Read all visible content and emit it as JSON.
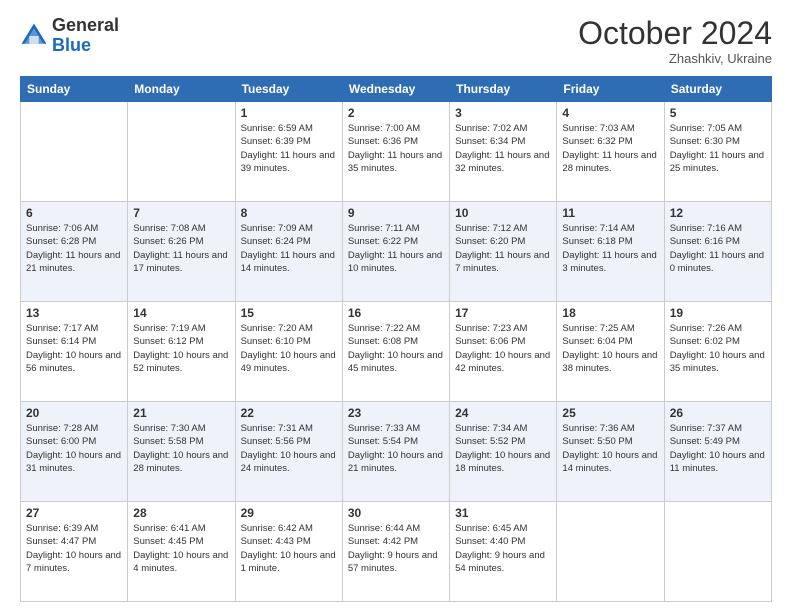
{
  "header": {
    "logo": {
      "general": "General",
      "blue": "Blue"
    },
    "title": "October 2024",
    "subtitle": "Zhashkiv, Ukraine"
  },
  "weekdays": [
    "Sunday",
    "Monday",
    "Tuesday",
    "Wednesday",
    "Thursday",
    "Friday",
    "Saturday"
  ],
  "weeks": [
    [
      {
        "day": "",
        "sunrise": "",
        "sunset": "",
        "daylight": "",
        "empty": true
      },
      {
        "day": "",
        "sunrise": "",
        "sunset": "",
        "daylight": "",
        "empty": true
      },
      {
        "day": "1",
        "sunrise": "Sunrise: 6:59 AM",
        "sunset": "Sunset: 6:39 PM",
        "daylight": "Daylight: 11 hours and 39 minutes.",
        "empty": false
      },
      {
        "day": "2",
        "sunrise": "Sunrise: 7:00 AM",
        "sunset": "Sunset: 6:36 PM",
        "daylight": "Daylight: 11 hours and 35 minutes.",
        "empty": false
      },
      {
        "day": "3",
        "sunrise": "Sunrise: 7:02 AM",
        "sunset": "Sunset: 6:34 PM",
        "daylight": "Daylight: 11 hours and 32 minutes.",
        "empty": false
      },
      {
        "day": "4",
        "sunrise": "Sunrise: 7:03 AM",
        "sunset": "Sunset: 6:32 PM",
        "daylight": "Daylight: 11 hours and 28 minutes.",
        "empty": false
      },
      {
        "day": "5",
        "sunrise": "Sunrise: 7:05 AM",
        "sunset": "Sunset: 6:30 PM",
        "daylight": "Daylight: 11 hours and 25 minutes.",
        "empty": false
      }
    ],
    [
      {
        "day": "6",
        "sunrise": "Sunrise: 7:06 AM",
        "sunset": "Sunset: 6:28 PM",
        "daylight": "Daylight: 11 hours and 21 minutes.",
        "empty": false
      },
      {
        "day": "7",
        "sunrise": "Sunrise: 7:08 AM",
        "sunset": "Sunset: 6:26 PM",
        "daylight": "Daylight: 11 hours and 17 minutes.",
        "empty": false
      },
      {
        "day": "8",
        "sunrise": "Sunrise: 7:09 AM",
        "sunset": "Sunset: 6:24 PM",
        "daylight": "Daylight: 11 hours and 14 minutes.",
        "empty": false
      },
      {
        "day": "9",
        "sunrise": "Sunrise: 7:11 AM",
        "sunset": "Sunset: 6:22 PM",
        "daylight": "Daylight: 11 hours and 10 minutes.",
        "empty": false
      },
      {
        "day": "10",
        "sunrise": "Sunrise: 7:12 AM",
        "sunset": "Sunset: 6:20 PM",
        "daylight": "Daylight: 11 hours and 7 minutes.",
        "empty": false
      },
      {
        "day": "11",
        "sunrise": "Sunrise: 7:14 AM",
        "sunset": "Sunset: 6:18 PM",
        "daylight": "Daylight: 11 hours and 3 minutes.",
        "empty": false
      },
      {
        "day": "12",
        "sunrise": "Sunrise: 7:16 AM",
        "sunset": "Sunset: 6:16 PM",
        "daylight": "Daylight: 11 hours and 0 minutes.",
        "empty": false
      }
    ],
    [
      {
        "day": "13",
        "sunrise": "Sunrise: 7:17 AM",
        "sunset": "Sunset: 6:14 PM",
        "daylight": "Daylight: 10 hours and 56 minutes.",
        "empty": false
      },
      {
        "day": "14",
        "sunrise": "Sunrise: 7:19 AM",
        "sunset": "Sunset: 6:12 PM",
        "daylight": "Daylight: 10 hours and 52 minutes.",
        "empty": false
      },
      {
        "day": "15",
        "sunrise": "Sunrise: 7:20 AM",
        "sunset": "Sunset: 6:10 PM",
        "daylight": "Daylight: 10 hours and 49 minutes.",
        "empty": false
      },
      {
        "day": "16",
        "sunrise": "Sunrise: 7:22 AM",
        "sunset": "Sunset: 6:08 PM",
        "daylight": "Daylight: 10 hours and 45 minutes.",
        "empty": false
      },
      {
        "day": "17",
        "sunrise": "Sunrise: 7:23 AM",
        "sunset": "Sunset: 6:06 PM",
        "daylight": "Daylight: 10 hours and 42 minutes.",
        "empty": false
      },
      {
        "day": "18",
        "sunrise": "Sunrise: 7:25 AM",
        "sunset": "Sunset: 6:04 PM",
        "daylight": "Daylight: 10 hours and 38 minutes.",
        "empty": false
      },
      {
        "day": "19",
        "sunrise": "Sunrise: 7:26 AM",
        "sunset": "Sunset: 6:02 PM",
        "daylight": "Daylight: 10 hours and 35 minutes.",
        "empty": false
      }
    ],
    [
      {
        "day": "20",
        "sunrise": "Sunrise: 7:28 AM",
        "sunset": "Sunset: 6:00 PM",
        "daylight": "Daylight: 10 hours and 31 minutes.",
        "empty": false
      },
      {
        "day": "21",
        "sunrise": "Sunrise: 7:30 AM",
        "sunset": "Sunset: 5:58 PM",
        "daylight": "Daylight: 10 hours and 28 minutes.",
        "empty": false
      },
      {
        "day": "22",
        "sunrise": "Sunrise: 7:31 AM",
        "sunset": "Sunset: 5:56 PM",
        "daylight": "Daylight: 10 hours and 24 minutes.",
        "empty": false
      },
      {
        "day": "23",
        "sunrise": "Sunrise: 7:33 AM",
        "sunset": "Sunset: 5:54 PM",
        "daylight": "Daylight: 10 hours and 21 minutes.",
        "empty": false
      },
      {
        "day": "24",
        "sunrise": "Sunrise: 7:34 AM",
        "sunset": "Sunset: 5:52 PM",
        "daylight": "Daylight: 10 hours and 18 minutes.",
        "empty": false
      },
      {
        "day": "25",
        "sunrise": "Sunrise: 7:36 AM",
        "sunset": "Sunset: 5:50 PM",
        "daylight": "Daylight: 10 hours and 14 minutes.",
        "empty": false
      },
      {
        "day": "26",
        "sunrise": "Sunrise: 7:37 AM",
        "sunset": "Sunset: 5:49 PM",
        "daylight": "Daylight: 10 hours and 11 minutes.",
        "empty": false
      }
    ],
    [
      {
        "day": "27",
        "sunrise": "Sunrise: 6:39 AM",
        "sunset": "Sunset: 4:47 PM",
        "daylight": "Daylight: 10 hours and 7 minutes.",
        "empty": false
      },
      {
        "day": "28",
        "sunrise": "Sunrise: 6:41 AM",
        "sunset": "Sunset: 4:45 PM",
        "daylight": "Daylight: 10 hours and 4 minutes.",
        "empty": false
      },
      {
        "day": "29",
        "sunrise": "Sunrise: 6:42 AM",
        "sunset": "Sunset: 4:43 PM",
        "daylight": "Daylight: 10 hours and 1 minute.",
        "empty": false
      },
      {
        "day": "30",
        "sunrise": "Sunrise: 6:44 AM",
        "sunset": "Sunset: 4:42 PM",
        "daylight": "Daylight: 9 hours and 57 minutes.",
        "empty": false
      },
      {
        "day": "31",
        "sunrise": "Sunrise: 6:45 AM",
        "sunset": "Sunset: 4:40 PM",
        "daylight": "Daylight: 9 hours and 54 minutes.",
        "empty": false
      },
      {
        "day": "",
        "sunrise": "",
        "sunset": "",
        "daylight": "",
        "empty": true
      },
      {
        "day": "",
        "sunrise": "",
        "sunset": "",
        "daylight": "",
        "empty": true
      }
    ]
  ]
}
